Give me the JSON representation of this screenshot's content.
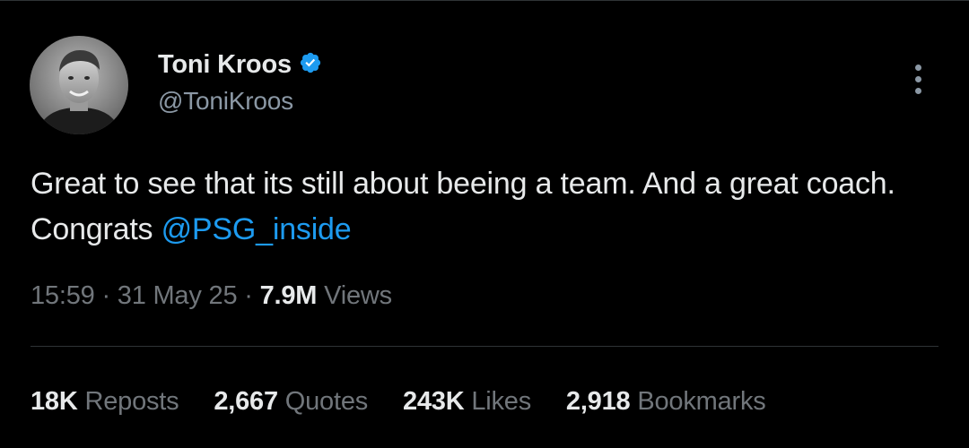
{
  "author": {
    "display_name": "Toni Kroos",
    "handle": "@ToniKroos",
    "verified_badge_color": "#1d9bf0",
    "verified_icon": "verified-badge-icon"
  },
  "menu": {
    "icon": "more-options-icon"
  },
  "tweet": {
    "text_before_mention": "Great to see that its still about beeing a team. And a great coach. Congrats ",
    "mention": "@PSG_inside",
    "mention_color": "#1d9bf0"
  },
  "meta": {
    "time": "15:59",
    "separator": "·",
    "date": "31 May 25",
    "views_count": "7.9M",
    "views_label": "Views"
  },
  "stats": {
    "reposts_count": "18K",
    "reposts_label": "Reposts",
    "quotes_count": "2,667",
    "quotes_label": "Quotes",
    "likes_count": "243K",
    "likes_label": "Likes",
    "bookmarks_count": "2,918",
    "bookmarks_label": "Bookmarks"
  },
  "colors": {
    "background": "#000000",
    "primary_text": "#e7e9ea",
    "secondary_text": "#71767b",
    "handle_text": "#8b98a5",
    "divider": "#2f3336"
  }
}
